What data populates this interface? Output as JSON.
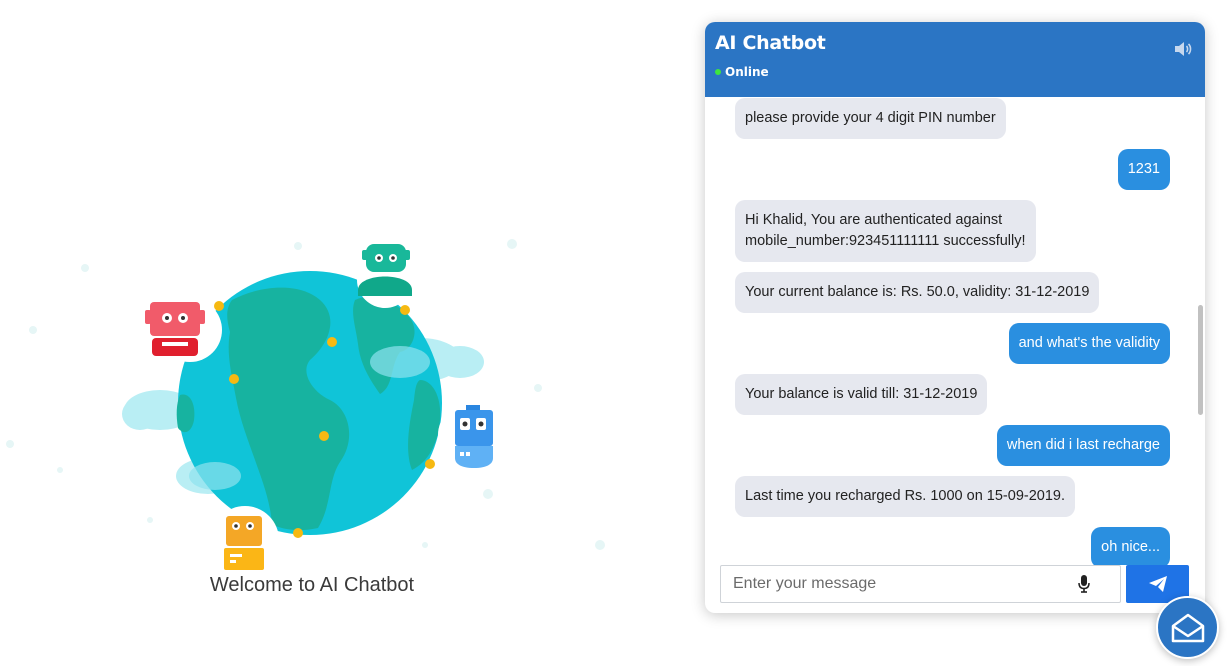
{
  "hero": {
    "welcome_text": "Welcome to AI Chatbot"
  },
  "chat": {
    "title": "AI Chatbot",
    "status": "Online",
    "colors": {
      "header": "#2b75c4",
      "user_bubble": "#2a8fe0",
      "bot_bubble": "#e6e8ef",
      "send": "#1f73e6",
      "online": "#3ee63e"
    },
    "messages": [
      {
        "from": "bot",
        "text": "please provide your 4 digit PIN number"
      },
      {
        "from": "user",
        "text": "1231"
      },
      {
        "from": "bot",
        "line1": "Hi Khalid, You are authenticated against",
        "line2": "mobile_number:923451111111 successfully!"
      },
      {
        "from": "bot",
        "text": "Your current balance is: Rs. 50.0, validity: 31-12-2019"
      },
      {
        "from": "user",
        "text": "and what's the validity"
      },
      {
        "from": "bot",
        "text": "Your balance is valid till: 31-12-2019"
      },
      {
        "from": "user",
        "text": "when did i last recharge"
      },
      {
        "from": "bot",
        "text": "Last time you recharged Rs. 1000 on 15-09-2019."
      },
      {
        "from": "user",
        "text": "oh nice..."
      }
    ],
    "input": {
      "placeholder": "Enter your message",
      "value": ""
    },
    "icons": {
      "speaker": "speaker-icon",
      "mic": "microphone-icon",
      "send": "paper-plane-icon",
      "launcher": "envelope-open-icon"
    }
  }
}
